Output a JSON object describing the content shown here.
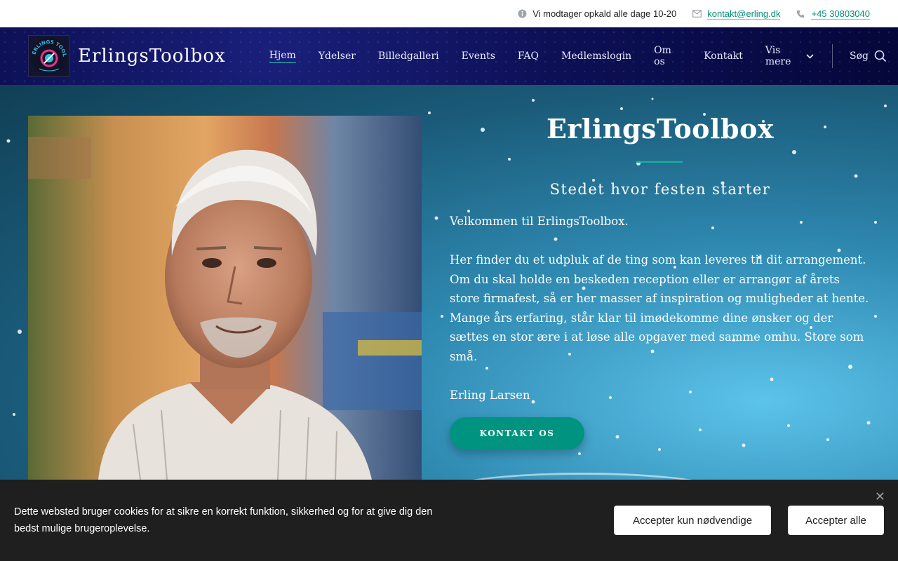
{
  "topbar": {
    "hours_text": "Vi modtager opkald alle dage 10-20",
    "email": "kontakt@erling.dk",
    "phone": "+45 30803040",
    "icons": [
      "info-icon",
      "mail-icon",
      "phone-icon"
    ]
  },
  "nav": {
    "brand": "ErlingsToolbox",
    "items": [
      "Hjem",
      "Ydelser",
      "Billedgalleri",
      "Events",
      "FAQ",
      "Medlemslogin",
      "Om os",
      "Kontakt",
      "Vis mere"
    ],
    "active_item": "Hjem",
    "search_label": "Søg"
  },
  "hero": {
    "title": "ErlingsToolbox",
    "subtitle": "Stedet hvor festen starter",
    "paragraphs": [
      "Velkommen til ErlingsToolbox.",
      "",
      "Her finder du et udpluk af de ting som kan leveres til dit arrangement.",
      "Om du skal holde en beskeden reception eller er arrangør af årets store firmafest, så er her masser af inspiration og muligheder at hente.",
      "Mange års erfaring, står klar til imødekomme dine ønsker og der sættes en stor ære i at løse alle opgaver med samme omhu. Store som små.",
      "",
      "Erling Larsen"
    ],
    "cta_label": "KONTAKT OS"
  },
  "cookie": {
    "text": "Dette websted bruger cookies for at sikre en korrekt funktion, sikkerhed og for at give dig den bedst mulige brugeroplevelse.",
    "btn_necessary": "Accepter kun nødvendige",
    "btn_all": "Accepter alle",
    "close_symbol": "✕"
  },
  "colors": {
    "accent": "#00937f",
    "nav_bg": "#0d1055",
    "cookie_bg": "#1f1f1f"
  }
}
